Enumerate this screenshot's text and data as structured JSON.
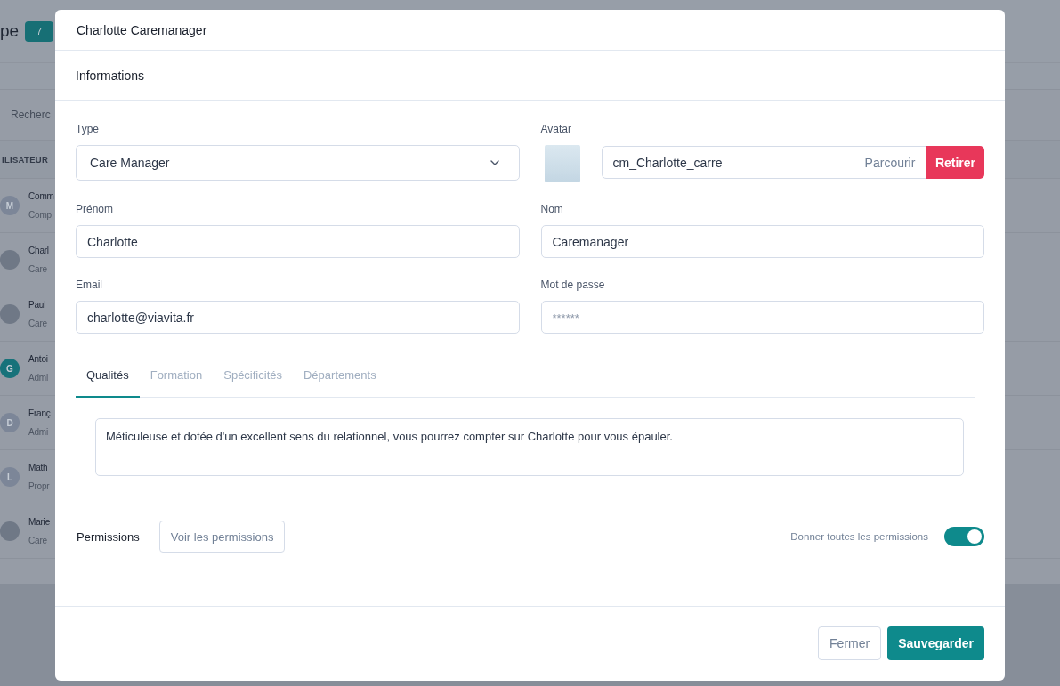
{
  "background_page": {
    "title": "pe",
    "count": "7",
    "search": {
      "placeholder": "Recherc"
    },
    "table": {
      "column_1": "ILISATEUR",
      "rows": [
        {
          "avatar": {
            "kind": "initials",
            "initials": "M",
            "color": "#7c8698"
          },
          "name": "Comm",
          "role": "Comp"
        },
        {
          "avatar": {
            "kind": "photo"
          },
          "name": "Charl",
          "role": "Care"
        },
        {
          "avatar": {
            "kind": "photo"
          },
          "name": "Paul",
          "role": "Care"
        },
        {
          "avatar": {
            "kind": "initials",
            "initials": "G",
            "color": "#17727a"
          },
          "name": "Antoi",
          "role": "Admi"
        },
        {
          "avatar": {
            "kind": "initials",
            "initials": "D",
            "color": "#7c8698"
          },
          "name": "Franç",
          "role": "Admi"
        },
        {
          "avatar": {
            "kind": "initials",
            "initials": "L",
            "color": "#7c8698"
          },
          "name": "Math",
          "role": "Propr"
        },
        {
          "avatar": {
            "kind": "photo"
          },
          "name": "Marie",
          "role": "Care"
        }
      ]
    }
  },
  "modal": {
    "title": "Charlotte Caremanager",
    "section_title": "Informations",
    "fields": [
      {
        "kind": "select",
        "label": "Type",
        "value": "Care Manager"
      },
      {
        "kind": "file",
        "label": "Avatar",
        "value": "cm_Charlotte_carre",
        "browse_button": "Parcourir",
        "remove_button": "Retirer"
      },
      {
        "kind": "text",
        "label": "Prénom",
        "value": "Charlotte"
      },
      {
        "kind": "text",
        "label": "Nom",
        "value": "Caremanager"
      },
      {
        "kind": "text",
        "label": "Email",
        "value": "charlotte@viavita.fr"
      },
      {
        "kind": "password",
        "label": "Mot de passe",
        "placeholder": "******"
      }
    ],
    "tabs": [
      {
        "label": "Qualités",
        "selected": true
      },
      {
        "label": "Formation",
        "selected": false
      },
      {
        "label": "Spécificités",
        "selected": false
      },
      {
        "label": "Départements",
        "selected": false
      }
    ],
    "tab_content": "Méticuleuse et dotée d'un excellent sens du relationnel, vous pourrez compter sur Charlotte pour vous épauler.",
    "permissions": {
      "label": "Permissions",
      "view_button": "Voir les permissions",
      "toggle_label": "Donner toutes les permissions",
      "all_permissions_on": true
    },
    "buttons": [
      {
        "label": "Fermer",
        "kind": "secondary"
      },
      {
        "label": "Sauvegarder",
        "kind": "primary"
      }
    ]
  }
}
